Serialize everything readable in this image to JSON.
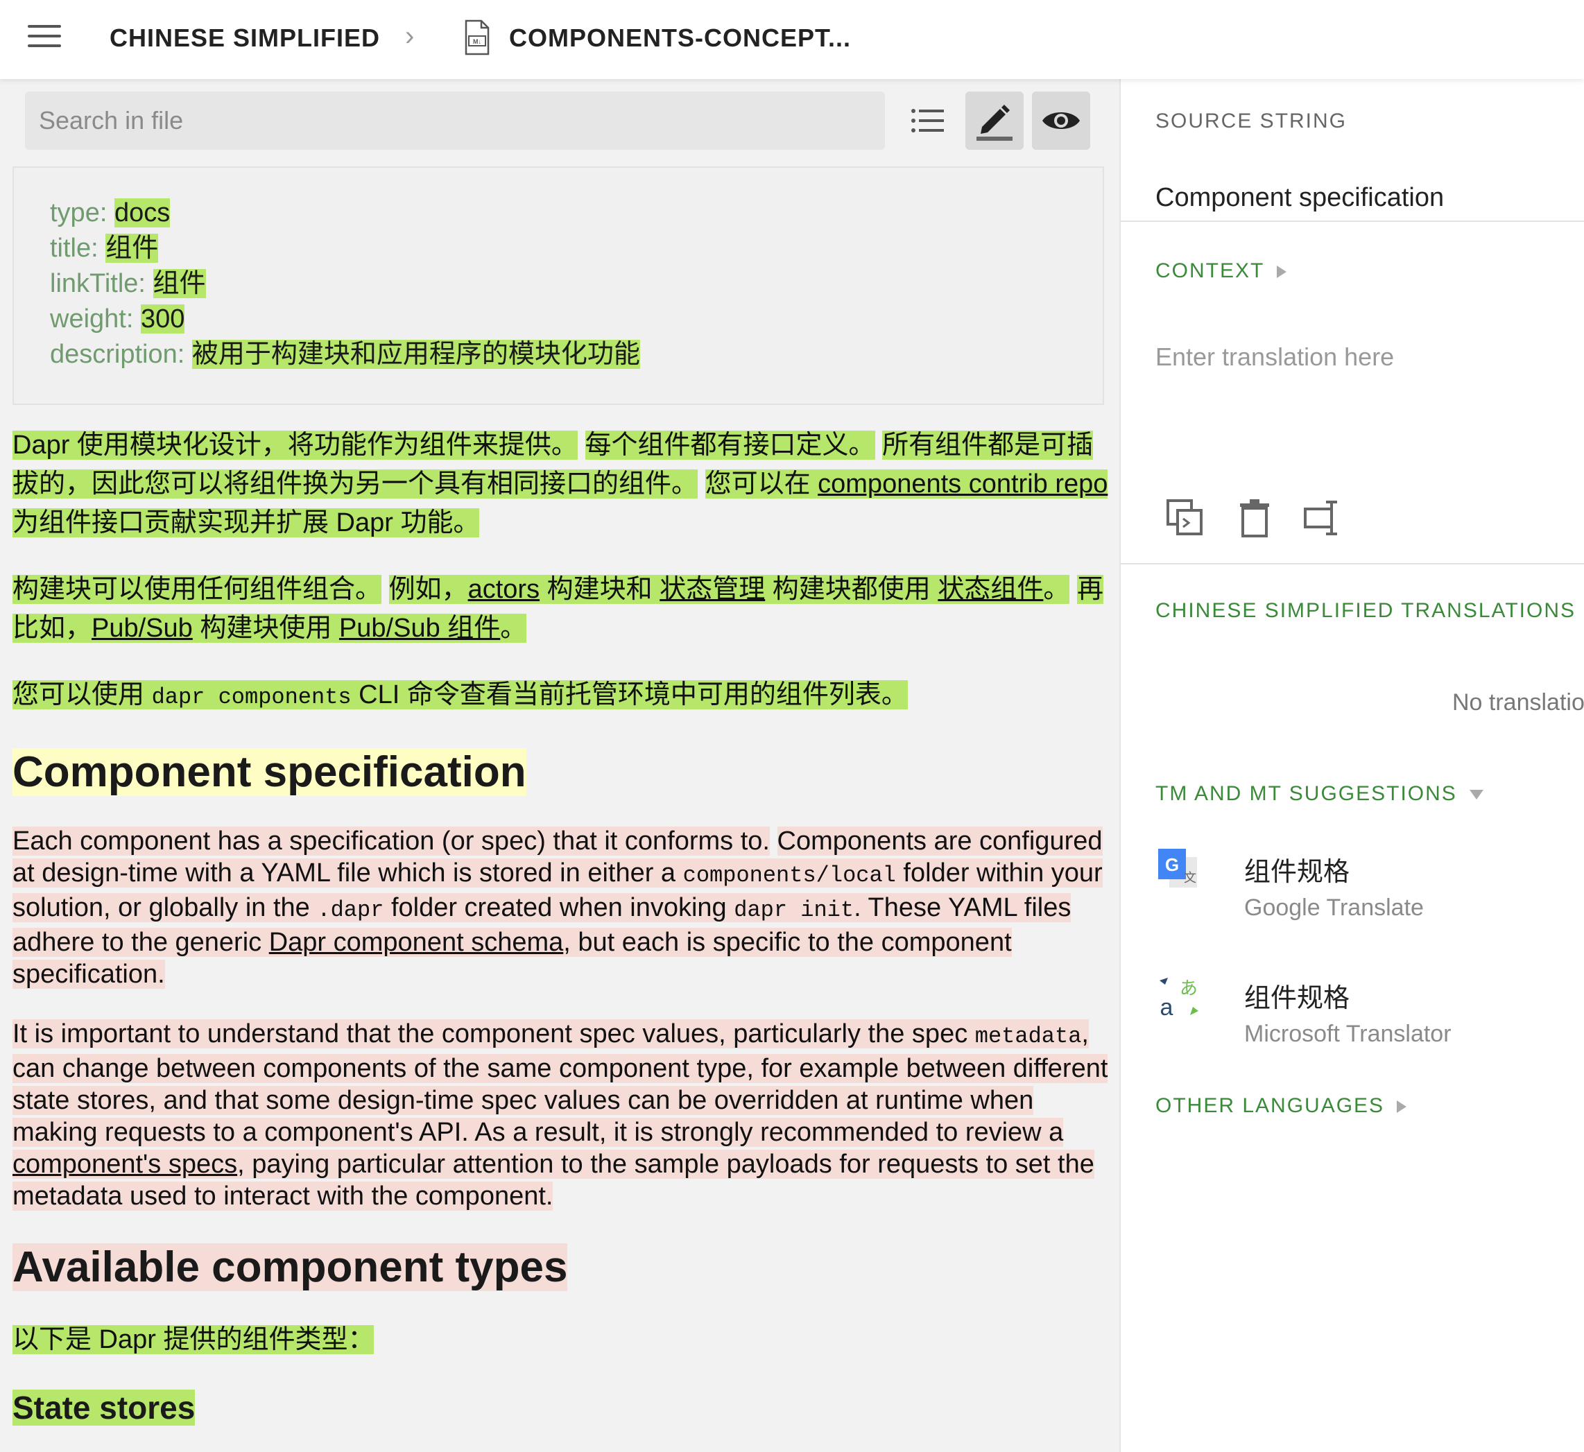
{
  "breadcrumb": {
    "language": "CHINESE SIMPLIFIED",
    "file": "COMPONENTS-CONCEPT..."
  },
  "toolbar": {
    "search_placeholder": "Search in file"
  },
  "frontmatter": [
    {
      "key": "type:",
      "value": "docs"
    },
    {
      "key": "title:",
      "value": "组件"
    },
    {
      "key": "linkTitle:",
      "value": "组件"
    },
    {
      "key": "weight:",
      "value": "300"
    },
    {
      "key": "description:",
      "value": "被用于构建块和应用程序的模块化功能"
    }
  ],
  "content": {
    "p1_a": "Dapr 使用模块化设计，将功能作为组件来提供。",
    "p1_b": "每个组件都有接口定义。",
    "p1_c": "所有组件都是可插拔的，因此您可以将组件换为另一个具有相同接口的组件。",
    "p1_d": "您可以在 ",
    "p1_link": "components contrib repo",
    "p1_e": " 为组件接口贡献实现并扩展 Dapr 功能。",
    "p2_a": "构建块可以使用任何组件组合。",
    "p2_b": "例如，",
    "p2_link1": "actors",
    "p2_c": " 构建块和 ",
    "p2_link2": "状态管理",
    "p2_d": " 构建块都使用 ",
    "p2_link3": "状态组件",
    "p2_e": "。",
    "p2_f": "再比如，",
    "p2_link4": "Pub/Sub",
    "p2_g": " 构建块使用 ",
    "p2_link5": "Pub/Sub 组件",
    "p2_h": "。",
    "p3_a": "您可以使用 ",
    "p3_code": "dapr components",
    "p3_b": " CLI 命令查看当前托管环境中可用的组件列表。",
    "h_spec": "Component specification",
    "p4_a": "Each component has a specification (or spec) that it conforms to.",
    "p4_b": "Components are configured at design-time with a YAML file which is stored in either a ",
    "p4_code1": "components/local",
    "p4_c": " folder within your solution, or globally in the ",
    "p4_code2": ".dapr",
    "p4_d": " folder created when invoking ",
    "p4_code3": "dapr init",
    "p4_e": ".",
    "p4_f": " These YAML files adhere to the generic ",
    "p4_link": "Dapr component schema",
    "p4_g": ", but each is specific to the component specification.",
    "p5_a": "It is important to understand that the component spec values, particularly the spec ",
    "p5_code": "metadata",
    "p5_b": ", can change between components of the same component type, for example between different state stores, and that some design-time spec values can be overridden at runtime when making requests to a component's API.",
    "p5_c": " As a result, it is strongly recommended to review a ",
    "p5_link": "component's specs",
    "p5_d": ", paying particular attention to the sample payloads for requests to set the metadata used to interact with the component.",
    "h_types": "Available component types",
    "p6": "以下是 Dapr 提供的组件类型：",
    "h_state": "State stores"
  },
  "panel": {
    "source_label": "SOURCE STRING",
    "source_text": "Component specification",
    "context_label": "CONTEXT",
    "translation_placeholder": "Enter translation here",
    "translations_label": "CHINESE SIMPLIFIED TRANSLATIONS",
    "no_translations": "No translatio",
    "suggestions_label": "TM AND MT SUGGESTIONS",
    "suggestions": [
      {
        "text": "组件规格",
        "source": "Google Translate",
        "icon": "google-translate-icon"
      },
      {
        "text": "组件规格",
        "source": "Microsoft Translator",
        "icon": "microsoft-translator-icon"
      }
    ],
    "other_languages_label": "OTHER LANGUAGES"
  },
  "colors": {
    "translated": "#b6e66a",
    "untranslated": "#f5dcd7",
    "active": "#fdfdc4",
    "accent_green": "#3a8a3a"
  }
}
